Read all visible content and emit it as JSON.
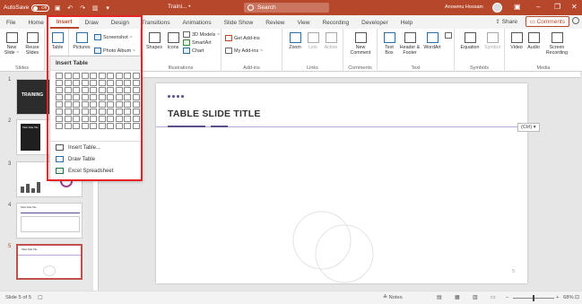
{
  "titlebar": {
    "autosave_label": "AutoSave",
    "autosave_state": "Off",
    "doc_title": "Traini... •",
    "search_placeholder": "Search",
    "user_name": "Anowmu Hossain",
    "accent_color": "#b7472a"
  },
  "tabs": [
    {
      "label": "File"
    },
    {
      "label": "Home"
    },
    {
      "label": "Insert",
      "active": true
    },
    {
      "label": "Draw"
    },
    {
      "label": "Design"
    },
    {
      "label": "Transitions"
    },
    {
      "label": "Animations"
    },
    {
      "label": "Slide Show"
    },
    {
      "label": "Review"
    },
    {
      "label": "View"
    },
    {
      "label": "Recording"
    },
    {
      "label": "Developer"
    },
    {
      "label": "Help"
    }
  ],
  "share_label": "Share",
  "comments_label": "Comments",
  "ribbon": {
    "slides": {
      "new_slide": "New Slide ~",
      "reuse_slides": "Reuse Slides",
      "group": "Slides"
    },
    "tables": {
      "table": "Table"
    },
    "images": {
      "pictures": "Pictures",
      "screenshot": "Screenshot ~",
      "photo_album": "Photo Album ~"
    },
    "illustrations": {
      "shapes": "Shapes",
      "icons": "Icons",
      "models": "3D Models ~",
      "smartart": "SmartArt",
      "chart": "Chart",
      "group": "Illustrations"
    },
    "addins": {
      "get_addins": "Get Add-ins",
      "my_addins": "My Add-ins ~",
      "group": "Add-ins"
    },
    "links": {
      "zoom": "Zoom",
      "link": "Link",
      "action": "Action",
      "group": "Links"
    },
    "comments": {
      "new_comment": "New Comment",
      "group": "Comments"
    },
    "text": {
      "text_box": "Text Box",
      "header_footer": "Header & Footer",
      "wordart": "WordArt",
      "group": "Text"
    },
    "symbols": {
      "equation": "Equation",
      "symbol": "Symbol",
      "group": "Symbols"
    },
    "media": {
      "video": "Video",
      "audio": "Audio",
      "screen_recording": "Screen Recording",
      "group": "Media"
    }
  },
  "table_dropdown": {
    "header": "Insert Table",
    "items": [
      "Insert Table...",
      "Draw Table",
      "Excel Spreadsheet"
    ]
  },
  "thumbnails": [
    {
      "num": "1",
      "caption": "TRAINING"
    },
    {
      "num": "2",
      "caption": "Table Slide Title"
    },
    {
      "num": "3"
    },
    {
      "num": "4",
      "caption": "Table Slide Title"
    },
    {
      "num": "5",
      "caption": "Table Slide Title",
      "active": true
    }
  ],
  "slide": {
    "title": "TABLE SLIDE TITLE",
    "ctrl_tag": "(Ctrl) ▾",
    "page": "5"
  },
  "statusbar": {
    "slide_info": "Slide 5 of 5",
    "notes": "Notes",
    "zoom": "68%"
  }
}
